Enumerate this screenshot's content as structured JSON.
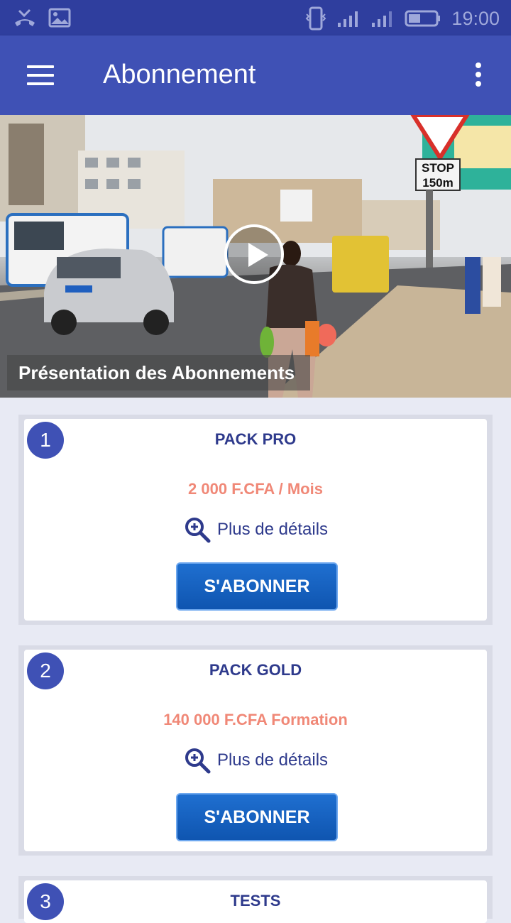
{
  "status_bar": {
    "time": "19:00",
    "icons": [
      "missed-call-icon",
      "image-icon",
      "vibrate-icon",
      "signal-icon",
      "signal-icon",
      "battery-icon"
    ]
  },
  "app_bar": {
    "title": "Abonnement",
    "menu_icon": "hamburger-menu-icon",
    "more_icon": "more-vertical-icon"
  },
  "hero": {
    "caption": "Présentation des Abonnements",
    "play_icon": "play-icon"
  },
  "packs": [
    {
      "number": "1",
      "title": "PACK PRO",
      "price": "2 000 F.CFA / Mois",
      "details_label": "Plus de détails",
      "subscribe_label": "S'ABONNER"
    },
    {
      "number": "2",
      "title": "PACK GOLD",
      "price": "140 000 F.CFA Formation",
      "details_label": "Plus de détails",
      "subscribe_label": "S'ABONNER"
    },
    {
      "number": "3",
      "title": "TESTS"
    }
  ],
  "colors": {
    "primary": "#3f51b5",
    "status_bar": "#2f3e9e",
    "title_text": "#2e3a8c",
    "price_text": "#f08877",
    "button": "#1565c0"
  }
}
